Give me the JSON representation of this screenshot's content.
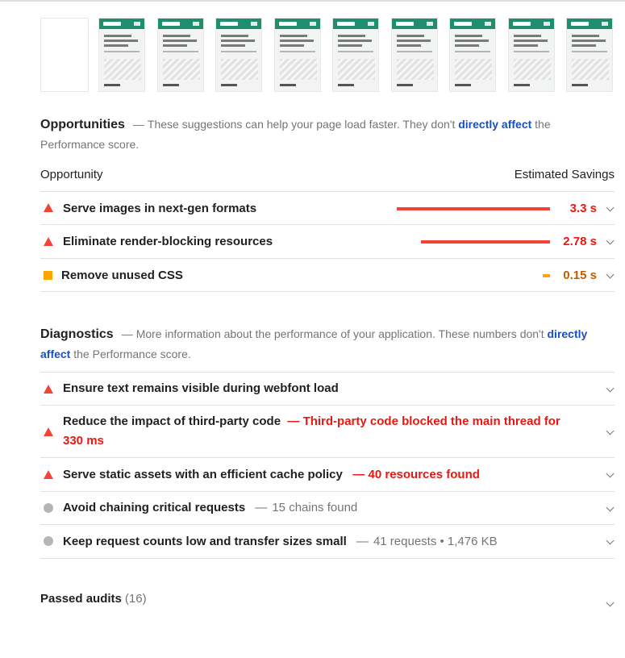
{
  "filmstrip": {
    "frame_count": 10,
    "frame_brand": "Koko Corp",
    "frame_heading": "CREATORS OF ROBOFRIENDS AND SMARTBRAIN"
  },
  "opportunities": {
    "title": "Opportunities",
    "desc_prefix": "These suggestions can help your page load faster. They don't",
    "link": "directly affect",
    "desc_suffix": "the Performance score.",
    "col_left": "Opportunity",
    "col_right": "Estimated Savings",
    "items": [
      {
        "label": "Serve images in next-gen formats",
        "value": "3.3 s",
        "severity": "fail",
        "bar_fraction": 1.0
      },
      {
        "label": "Eliminate render-blocking resources",
        "value": "2.78 s",
        "severity": "fail",
        "bar_fraction": 0.84
      },
      {
        "label": "Remove unused CSS",
        "value": "0.15 s",
        "severity": "average",
        "bar_fraction": 0.045
      }
    ]
  },
  "diagnostics": {
    "title": "Diagnostics",
    "desc_prefix": "More information about the performance of your application. These numbers don't",
    "link": "directly affect",
    "desc_suffix": "the Performance score.",
    "items": [
      {
        "label": "Ensure text remains visible during webfont load",
        "detail": "",
        "severity": "fail"
      },
      {
        "label": "Reduce the impact of third-party code",
        "detail": "Third-party code blocked the main thread for 330 ms",
        "severity": "fail"
      },
      {
        "label": "Serve static assets with an efficient cache policy",
        "detail": "40 resources found",
        "severity": "fail"
      },
      {
        "label": "Avoid chaining critical requests",
        "detail": "15 chains found",
        "severity": "info"
      },
      {
        "label": "Keep request counts low and transfer sizes small",
        "detail": "41 requests • 1,476 KB",
        "severity": "info"
      }
    ]
  },
  "passed": {
    "label": "Passed audits",
    "count": "(16)"
  },
  "colors": {
    "fail": "#f44336",
    "average": "#ffa400",
    "info": "#b5b5b5",
    "link": "#1a4fbf"
  }
}
